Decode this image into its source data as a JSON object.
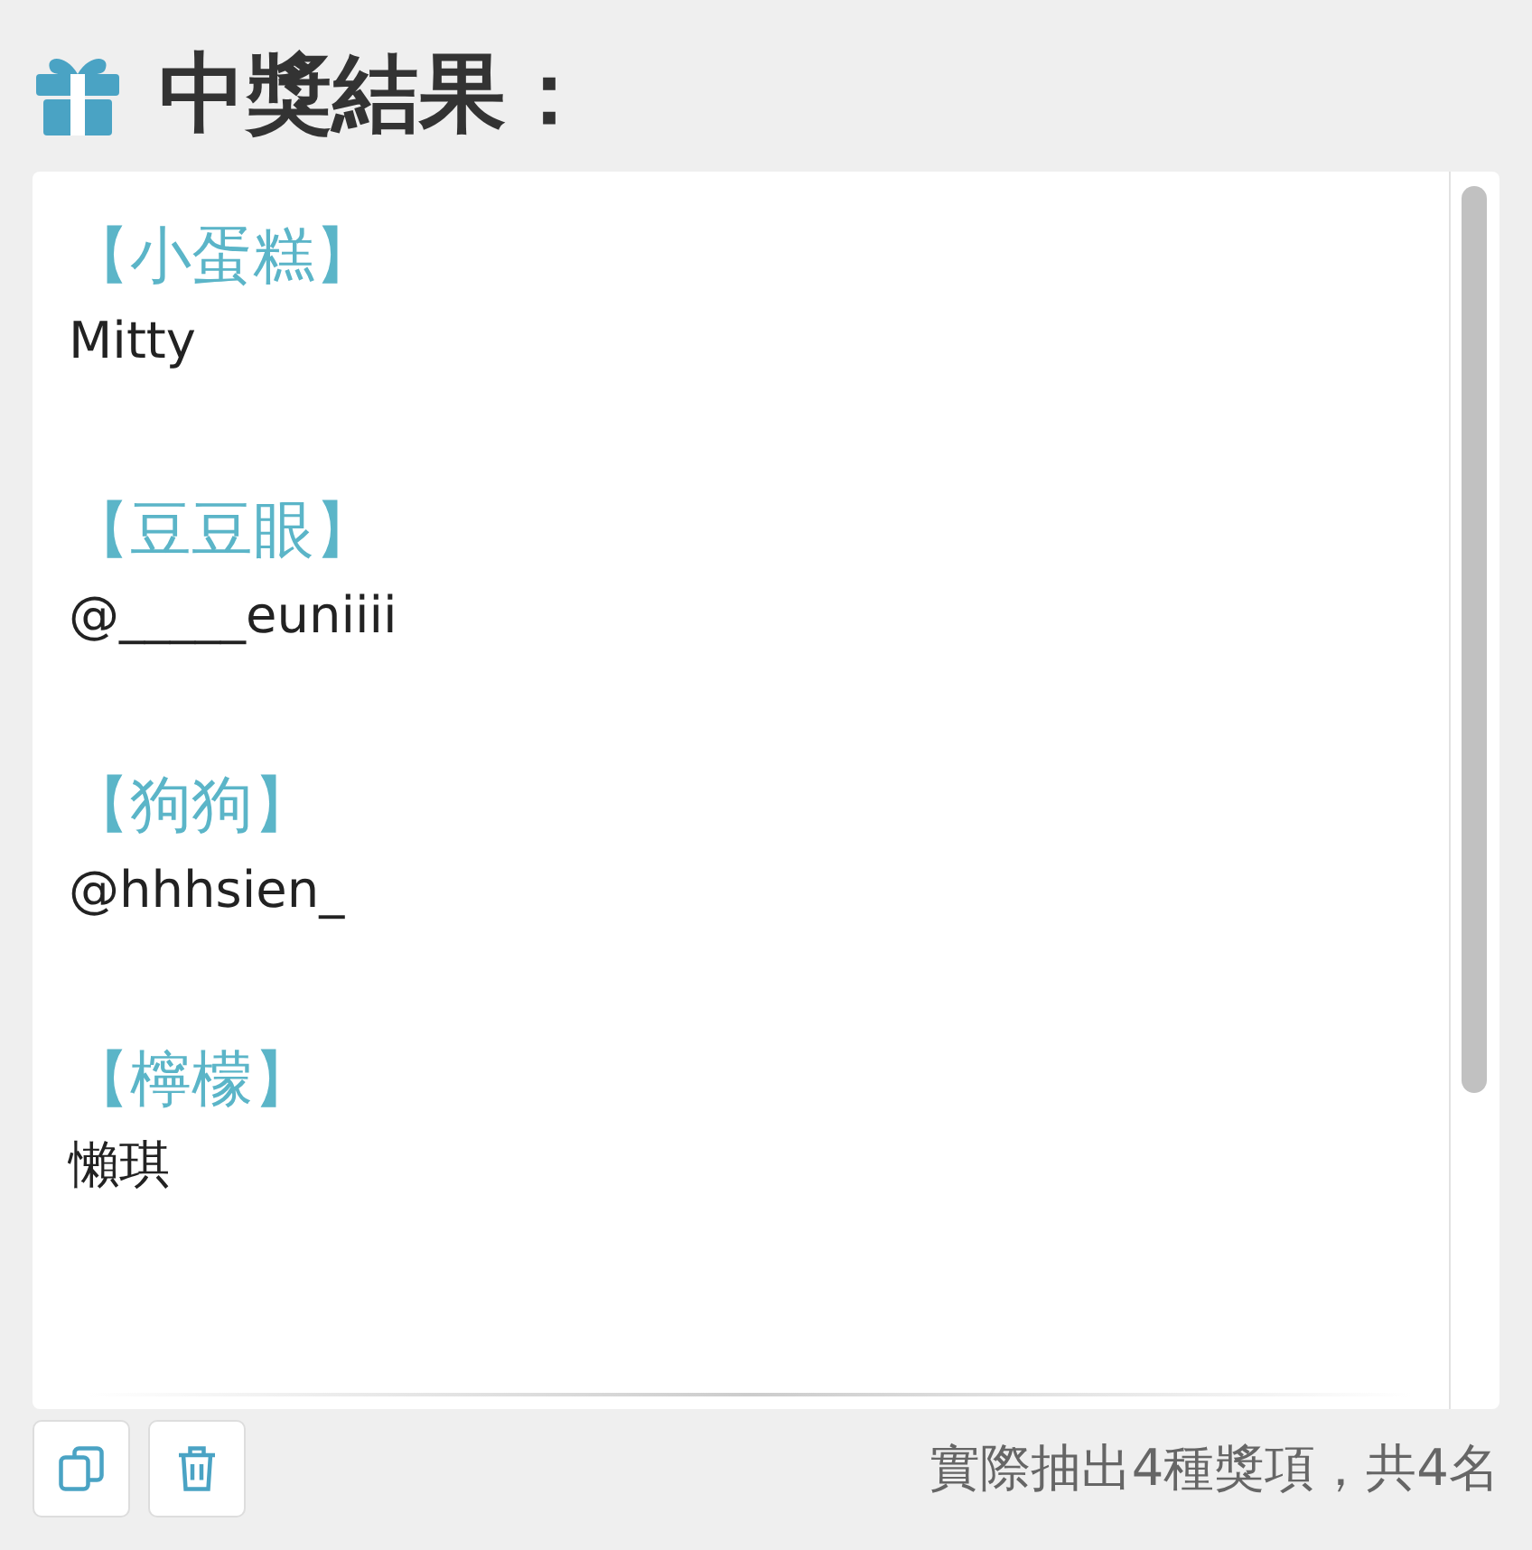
{
  "title": "中獎結果：",
  "results": [
    {
      "prize": "【小蛋糕】",
      "winner": "Mitty"
    },
    {
      "prize": "【豆豆眼】",
      "winner": "@_____euniiii"
    },
    {
      "prize": "【狗狗】",
      "winner": "@hhhsien_"
    },
    {
      "prize": "【檸檬】",
      "winner": "懶琪"
    }
  ],
  "summary": "實際抽出4種獎項，共4名"
}
